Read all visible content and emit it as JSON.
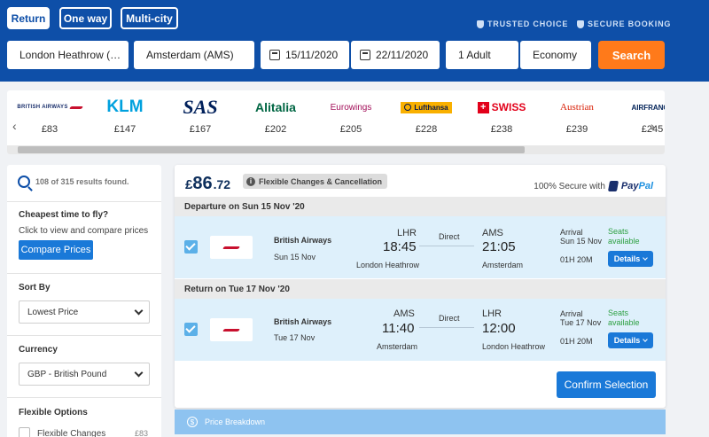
{
  "trip_types": [
    {
      "label": "Return",
      "active": true
    },
    {
      "label": "One way",
      "active": false
    },
    {
      "label": "Multi-city",
      "active": false
    }
  ],
  "trust": {
    "trusted": "TRUSTED CHOICE",
    "secure": "SECURE BOOKING"
  },
  "search": {
    "origin": "London Heathrow (…",
    "destination": "Amsterdam (AMS)",
    "depart_date": "15/11/2020",
    "return_date": "22/11/2020",
    "passengers": "1 Adult",
    "cabin": "Economy",
    "search_label": "Search"
  },
  "airlines": [
    {
      "name": "BRITISH AIRWAYS",
      "price": "£83"
    },
    {
      "name": "KLM",
      "price": "£147"
    },
    {
      "name": "SAS",
      "price": "£167"
    },
    {
      "name": "Alitalia",
      "price": "£202"
    },
    {
      "name": "Eurowings",
      "price": "£205"
    },
    {
      "name": "Lufthansa",
      "price": "£228"
    },
    {
      "name": "SWISS",
      "price": "£238"
    },
    {
      "name": "Austrian",
      "price": "£239"
    },
    {
      "name": "AIRFRANCE",
      "price": "£245"
    }
  ],
  "sidebar": {
    "results_text": "108 of 315 results found.",
    "cheapest_title": "Cheapest time to fly?",
    "cheapest_text": "Click to view and compare prices",
    "compare_label": "Compare Prices",
    "sort_title": "Sort By",
    "sort_value": "Lowest Price",
    "currency_title": "Currency",
    "currency_value": "GBP - British Pound",
    "flexible_title": "Flexible Options",
    "flexible_option": "Flexible Changes",
    "flexible_price": "£83"
  },
  "result": {
    "currency_symbol": "£",
    "price_int": "86",
    "price_dec": ".72",
    "flex_badge": "Flexible Changes & Cancellation",
    "secure_text": "100% Secure with",
    "paypal_pay": "Pay",
    "paypal_pal": "Pal",
    "departure": {
      "header": "Departure on Sun 15 Nov '20",
      "airline": "British Airways",
      "date": "Sun 15 Nov",
      "from_code": "LHR",
      "from_time": "18:45",
      "from_city": "London Heathrow",
      "stops": "Direct",
      "to_code": "AMS",
      "to_time": "21:05",
      "to_city": "Amsterdam",
      "arrival_label": "Arrival",
      "arrival_date": "Sun 15 Nov",
      "duration": "01H 20M",
      "seats_1": "Seats",
      "seats_2": "available",
      "details_label": "Details"
    },
    "return": {
      "header": "Return on Tue 17 Nov '20",
      "airline": "British Airways",
      "date": "Tue 17 Nov",
      "from_code": "AMS",
      "from_time": "11:40",
      "from_city": "Amsterdam",
      "stops": "Direct",
      "to_code": "LHR",
      "to_time": "12:00",
      "to_city": "London Heathrow",
      "arrival_label": "Arrival",
      "arrival_date": "Tue 17 Nov",
      "duration": "01H 20M",
      "seats_1": "Seats",
      "seats_2": "available",
      "details_label": "Details"
    },
    "confirm_label": "Confirm Selection",
    "breakdown_label": "Price Breakdown"
  },
  "colors": {
    "brand_blue": "#0e4fa8",
    "search_orange": "#ff7a1a",
    "button_blue": "#1a79d8",
    "seats_green": "#2ea043"
  }
}
